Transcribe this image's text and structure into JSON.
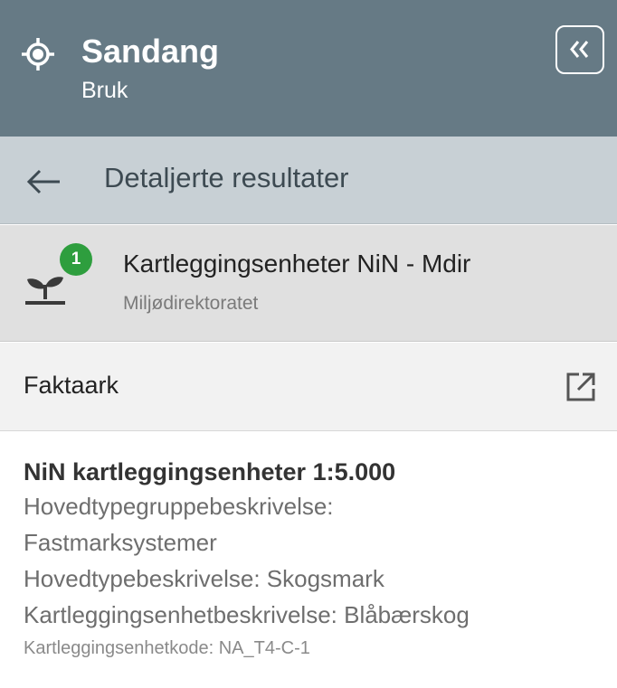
{
  "header": {
    "title": "Sandang",
    "subtitle": "Bruk",
    "location_icon": "location-crosshair-icon",
    "collapse_icon": "double-chevron-left-icon",
    "background_color": "#667a85"
  },
  "backbar": {
    "label": "Detaljerte resultater",
    "back_icon": "arrow-left-icon",
    "background_color": "#c8d0d5"
  },
  "layer": {
    "name": "Kartleggingsenheter NiN - Mdir",
    "source": "Miljødirektoratet",
    "badge_count": "1",
    "badge_color": "#2e9e3e",
    "icon": "plant-sprout-icon"
  },
  "faktaark": {
    "label": "Faktaark",
    "link_icon": "open-in-new-icon"
  },
  "details": {
    "heading": "NiN kartleggingsenheter 1:5.000",
    "rows": [
      "Hovedtypegruppebeskrivelse:",
      "Fastmarksystemer",
      "Hovedtypebeskrivelse: Skogsmark",
      "Kartleggingsenhetbeskrivelse: Blåbærskog"
    ],
    "code": "Kartleggingsenhetkode: NA_T4-C-1"
  }
}
